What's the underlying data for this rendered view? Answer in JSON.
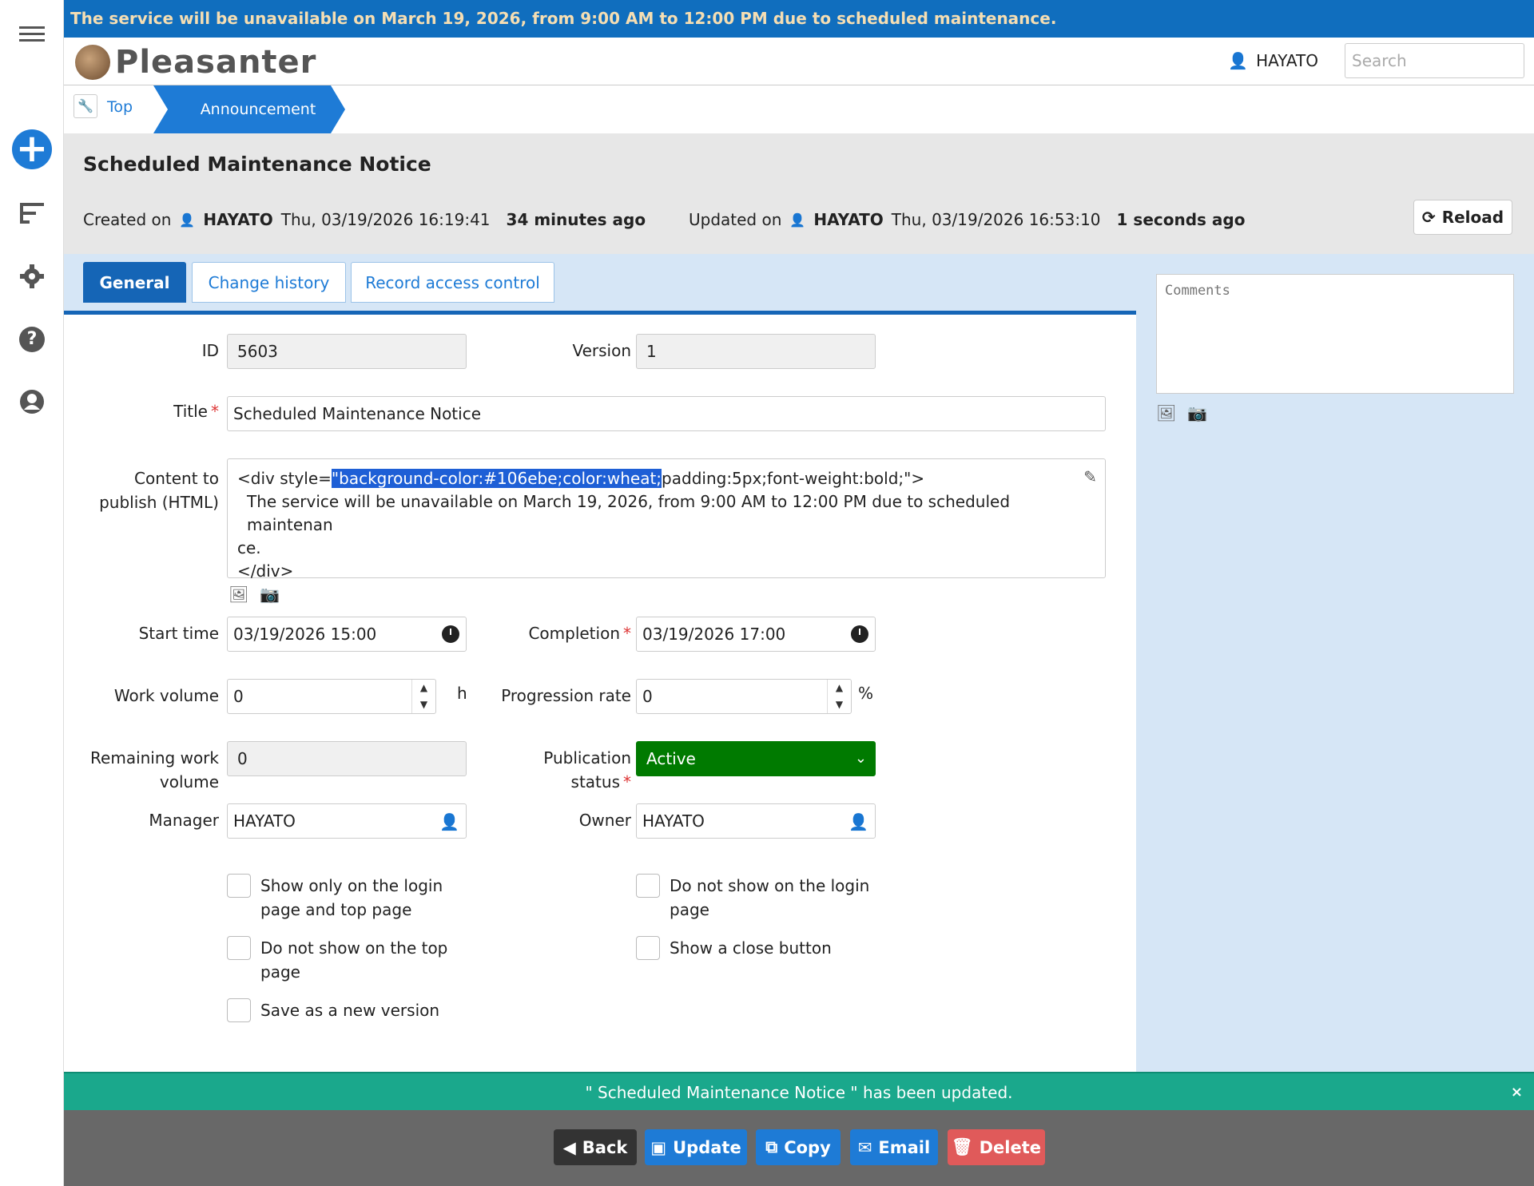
{
  "banner": {
    "text": "The service will be unavailable on March 19, 2026, from 9:00 AM to 12:00 PM due to scheduled maintenance."
  },
  "header": {
    "logo_text": "Pleasanter",
    "user": "HAYATO",
    "search_placeholder": "Search"
  },
  "breadcrumb": {
    "top": "Top",
    "current": "Announcement"
  },
  "record": {
    "title": "Scheduled Maintenance Notice",
    "created_label": "Created on",
    "created_by": "HAYATO",
    "created_at": "Thu, 03/19/2026 16:19:41",
    "created_ago": "34 minutes ago",
    "updated_label": "Updated on",
    "updated_by": "HAYATO",
    "updated_at": "Thu, 03/19/2026 16:53:10",
    "updated_ago": "1 seconds ago",
    "reload_label": "Reload"
  },
  "tabs": [
    {
      "label": "General"
    },
    {
      "label": "Change history"
    },
    {
      "label": "Record access control"
    }
  ],
  "comments": {
    "placeholder": "Comments"
  },
  "form": {
    "id_label": "ID",
    "id_value": "5603",
    "version_label": "Version",
    "version_value": "1",
    "title_label": "Title",
    "title_value": "Scheduled Maintenance Notice",
    "content_label_1": "Content to",
    "content_label_2": "publish (HTML)",
    "content_line1_pre": "<div style=",
    "content_line1_hl": "\"background-color:#106ebe;color:wheat;",
    "content_line1_post": "padding:5px;font-weight:bold;\">",
    "content_line2": "The service will be unavailable on March 19, 2026, from 9:00 AM to 12:00 PM due to scheduled maintenan",
    "content_line3": "ce.",
    "content_line4": "</div>",
    "start_label": "Start time",
    "start_value": "03/19/2026 15:00",
    "completion_label": "Completion",
    "completion_value": "03/19/2026 17:00",
    "work_label": "Work volume",
    "work_value": "0",
    "work_unit": "h",
    "progress_label": "Progression rate",
    "progress_value": "0",
    "progress_unit": "%",
    "remaining_label_1": "Remaining work",
    "remaining_label_2": "volume",
    "remaining_value": "0",
    "pubstatus_label_1": "Publication",
    "pubstatus_label_2": "status",
    "pubstatus_value": "Active",
    "manager_label": "Manager",
    "manager_value": "HAYATO",
    "owner_label": "Owner",
    "owner_value": "HAYATO",
    "chk_login_top_1": "Show only on the login",
    "chk_login_top_2": "page and top page",
    "chk_not_login_1": "Do not show on the login",
    "chk_not_login_2": "page",
    "chk_not_top_1": "Do not show on the top",
    "chk_not_top_2": "page",
    "chk_close": "Show a close button",
    "chk_new_version": "Save as a new version"
  },
  "message": {
    "text": "\" Scheduled Maintenance Notice \" has been updated.",
    "close": "×"
  },
  "footer": {
    "back": "Back",
    "update": "Update",
    "copy": "Copy",
    "email": "Email",
    "delete": "Delete"
  },
  "colors": {
    "banner_bg": "#106ebe",
    "banner_fg": "wheat",
    "accent": "#1e7bd6",
    "active_green": "#007a00",
    "success": "#1aa88c",
    "delete": "#e05a5a",
    "back": "#333333"
  },
  "icons": [
    "menu-icon",
    "plus-icon",
    "list-icon",
    "gear-icon",
    "help-icon",
    "user-icon",
    "wrench-icon",
    "reload-icon",
    "pencil-icon",
    "image-icon",
    "camera-icon",
    "clock-icon",
    "person-icon",
    "chevron-down-icon",
    "close-icon"
  ]
}
